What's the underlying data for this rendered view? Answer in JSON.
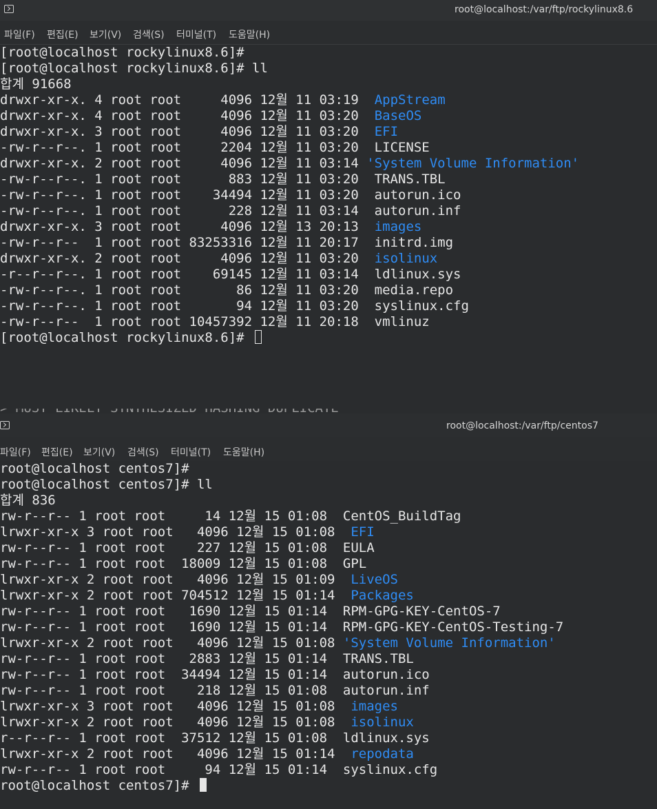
{
  "windows": [
    {
      "title": "root@localhost:/var/ftp/rockylinux8.6",
      "menu": [
        "파일(F)",
        "편집(E)",
        "보기(V)",
        "검색(S)",
        "터미널(T)",
        "도움말(H)"
      ],
      "lines": [
        [
          {
            "t": "[root@localhost rockylinux8.6]#"
          }
        ],
        [
          {
            "t": "[root@localhost rockylinux8.6]# ll"
          }
        ],
        [
          {
            "t": "합계 91668"
          }
        ],
        [
          {
            "t": "drwxr-xr-x. 4 root root     4096 12월 11 03:19  "
          },
          {
            "t": "AppStream",
            "c": "blue"
          }
        ],
        [
          {
            "t": "drwxr-xr-x. 4 root root     4096 12월 11 03:20  "
          },
          {
            "t": "BaseOS",
            "c": "blue"
          }
        ],
        [
          {
            "t": "drwxr-xr-x. 3 root root     4096 12월 11 03:20  "
          },
          {
            "t": "EFI",
            "c": "blue"
          }
        ],
        [
          {
            "t": "-rw-r--r--. 1 root root     2204 12월 11 03:20  LICENSE"
          }
        ],
        [
          {
            "t": "drwxr-xr-x. 2 root root     4096 12월 11 03:14 "
          },
          {
            "t": "'System Volume Information'",
            "c": "blue"
          }
        ],
        [
          {
            "t": "-rw-r--r--. 1 root root      883 12월 11 03:20  TRANS.TBL"
          }
        ],
        [
          {
            "t": "-rw-r--r--. 1 root root    34494 12월 11 03:20  autorun.ico"
          }
        ],
        [
          {
            "t": "-rw-r--r--. 1 root root      228 12월 11 03:14  autorun.inf"
          }
        ],
        [
          {
            "t": "drwxr-xr-x. 3 root root     4096 12월 13 20:13  "
          },
          {
            "t": "images",
            "c": "blue"
          }
        ],
        [
          {
            "t": "-rw-r--r--  1 root root 83253316 12월 11 20:17  initrd.img"
          }
        ],
        [
          {
            "t": "drwxr-xr-x. 2 root root     4096 12월 11 03:20  "
          },
          {
            "t": "isolinux",
            "c": "blue"
          }
        ],
        [
          {
            "t": "-r--r--r--. 1 root root    69145 12월 11 03:14  ldlinux.sys"
          }
        ],
        [
          {
            "t": "-rw-r--r--. 1 root root       86 12월 11 03:20  media.repo"
          }
        ],
        [
          {
            "t": "-rw-r--r--. 1 root root       94 12월 11 03:20  syslinux.cfg"
          }
        ],
        [
          {
            "t": "-rw-r--r--  1 root root 10457392 12월 11 20:18  vmlinuz"
          }
        ],
        [
          {
            "t": "[root@localhost rockylinux8.6]# "
          }
        ]
      ]
    },
    {
      "title": "root@localhost:/var/ftp/centos7",
      "menu": [
        "파일(F)",
        "편집(E)",
        "보기(V)",
        "검색(S)",
        "터미널(T)",
        "도움말(H)"
      ],
      "lines": [
        [
          {
            "t": "root@localhost centos7]#"
          }
        ],
        [
          {
            "t": "root@localhost centos7]# ll"
          }
        ],
        [
          {
            "t": "합계 836"
          }
        ],
        [
          {
            "t": "rw-r--r-- 1 root root     14 12월 15 01:08  CentOS_BuildTag"
          }
        ],
        [
          {
            "t": "lrwxr-xr-x 3 root root   4096 12월 15 01:08  "
          },
          {
            "t": "EFI",
            "c": "blue"
          }
        ],
        [
          {
            "t": "rw-r--r-- 1 root root    227 12월 15 01:08  EULA"
          }
        ],
        [
          {
            "t": "rw-r--r-- 1 root root  18009 12월 15 01:08  GPL"
          }
        ],
        [
          {
            "t": "lrwxr-xr-x 2 root root   4096 12월 15 01:09  "
          },
          {
            "t": "LiveOS",
            "c": "blue"
          }
        ],
        [
          {
            "t": "lrwxr-xr-x 2 root root 704512 12월 15 01:14  "
          },
          {
            "t": "Packages",
            "c": "blue"
          }
        ],
        [
          {
            "t": "rw-r--r-- 1 root root   1690 12월 15 01:14  RPM-GPG-KEY-CentOS-7"
          }
        ],
        [
          {
            "t": "rw-r--r-- 1 root root   1690 12월 15 01:14  RPM-GPG-KEY-CentOS-Testing-7"
          }
        ],
        [
          {
            "t": "lrwxr-xr-x 2 root root   4096 12월 15 01:08 "
          },
          {
            "t": "'System Volume Information'",
            "c": "blue"
          }
        ],
        [
          {
            "t": "rw-r--r-- 1 root root   2883 12월 15 01:14  TRANS.TBL"
          }
        ],
        [
          {
            "t": "rw-r--r-- 1 root root  34494 12월 15 01:14  autorun.ico"
          }
        ],
        [
          {
            "t": "rw-r--r-- 1 root root    218 12월 15 01:08  autorun.inf"
          }
        ],
        [
          {
            "t": "lrwxr-xr-x 3 root root   4096 12월 15 01:08  "
          },
          {
            "t": "images",
            "c": "blue"
          }
        ],
        [
          {
            "t": "lrwxr-xr-x 2 root root   4096 12월 15 01:08  "
          },
          {
            "t": "isolinux",
            "c": "blue"
          }
        ],
        [
          {
            "t": "r--r--r-- 1 root root  37512 12월 15 01:08  ldlinux.sys"
          }
        ],
        [
          {
            "t": "lrwxr-xr-x 2 root root   4096 12월 15 01:14  "
          },
          {
            "t": "repodata",
            "c": "blue"
          }
        ],
        [
          {
            "t": "rw-r--r-- 1 root root     94 12월 15 01:14  syslinux.cfg"
          }
        ],
        [
          {
            "t": "root@localhost centos7]# "
          }
        ]
      ]
    }
  ]
}
